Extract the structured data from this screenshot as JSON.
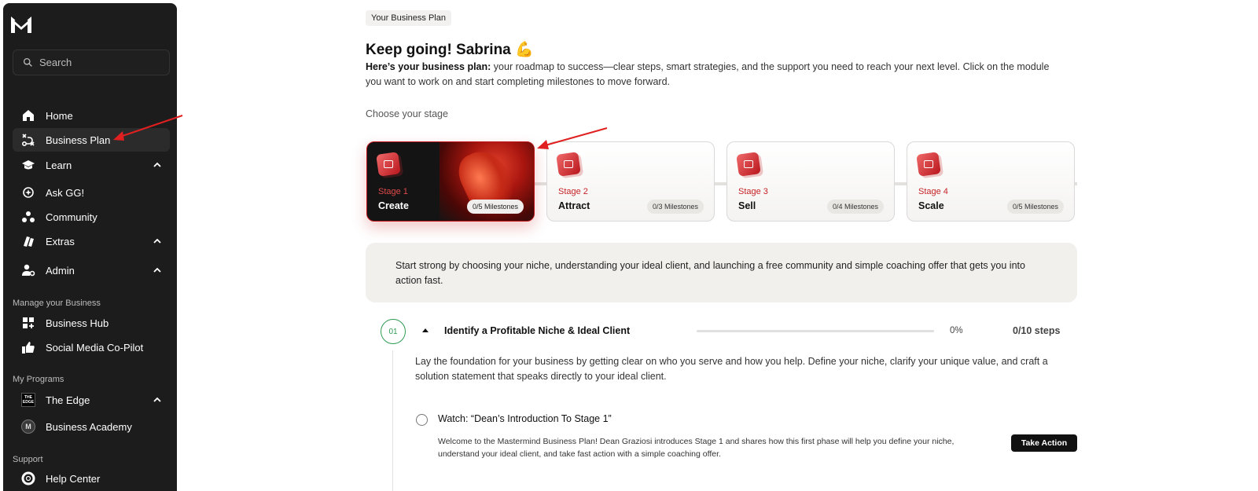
{
  "sidebar": {
    "search_placeholder": "Search",
    "nav": {
      "home": "Home",
      "business_plan": "Business Plan",
      "learn": "Learn",
      "ask_gg": "Ask GG!",
      "community": "Community",
      "extras": "Extras",
      "admin": "Admin"
    },
    "sections": {
      "manage": "Manage your Business",
      "programs": "My Programs",
      "support": "Support"
    },
    "manage_items": {
      "hub": "Business Hub",
      "copilot": "Social Media Co-Pilot"
    },
    "program_items": {
      "edge": "The Edge",
      "academy": "Business Academy"
    },
    "support_items": {
      "help": "Help Center"
    },
    "edge_badge": "THE EDGE",
    "academy_badge": "M"
  },
  "main": {
    "breadcrumb": "Your Business Plan",
    "title": "Keep going! Sabrina 💪",
    "intro_bold": "Here’s your business plan:",
    "intro_rest": " your roadmap to success—clear steps, smart strategies, and the support you need to reach your next level. Click on the module you want to work on and start completing milestones to move forward.",
    "choose_label": "Choose your stage",
    "stages": [
      {
        "label": "Stage 1",
        "name": "Create",
        "milestones": "0/5 Milestones"
      },
      {
        "label": "Stage 2",
        "name": "Attract",
        "milestones": "0/3 Milestones"
      },
      {
        "label": "Stage 3",
        "name": "Sell",
        "milestones": "0/4 Milestones"
      },
      {
        "label": "Stage 4",
        "name": "Scale",
        "milestones": "0/5 Milestones"
      }
    ],
    "stage_description": "Start strong by choosing your niche, understanding your ideal client, and launching a free community and simple coaching offer that gets you into action fast.",
    "module": {
      "number": "01",
      "title": "Identify a Profitable Niche & Ideal Client",
      "progress": 0,
      "percent_text": "0%",
      "steps_text": "0/10 steps",
      "description": "Lay the foundation for your business by getting clear on who you serve and how you help. Define your niche, clarify your unique value, and craft a solution statement that speaks directly to your ideal client."
    },
    "step": {
      "title": "Watch: “Dean’s Introduction To Stage 1”",
      "description": "Welcome to the Mastermind Business Plan! Dean Graziosi introduces Stage 1 and shares how this first phase will help you define your niche, understand your ideal client, and take fast action with a simple coaching offer.",
      "button": "Take Action"
    }
  },
  "colors": {
    "accent_red": "#c62226",
    "module_green": "#2f9a52",
    "sidebar_bg": "#1c1c1c"
  }
}
